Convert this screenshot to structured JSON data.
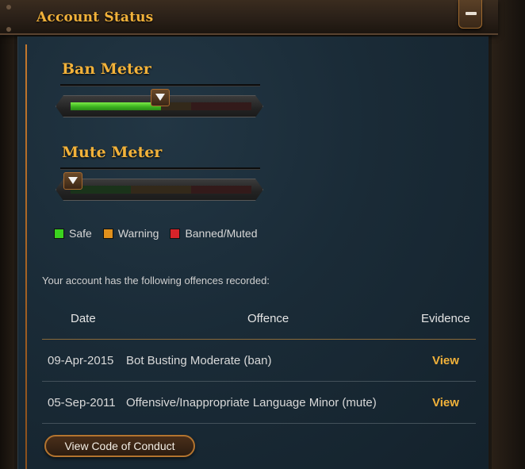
{
  "header": {
    "title": "Account Status"
  },
  "ban_meter": {
    "title": "Ban Meter",
    "level": 0.5
  },
  "mute_meter": {
    "title": "Mute Meter",
    "level": 0.0
  },
  "legend": [
    {
      "label": "Safe",
      "color": "#3bd21f"
    },
    {
      "label": "Warning",
      "color": "#e0901c"
    },
    {
      "label": "Banned/Muted",
      "color": "#d8232a"
    }
  ],
  "intro_text": "Your account has the following offences recorded:",
  "table": {
    "headers": {
      "date": "Date",
      "offence": "Offence",
      "evidence": "Evidence"
    },
    "rows": [
      {
        "date": "09-Apr-2015",
        "offence": "Bot Busting Moderate (ban)",
        "evidence": "View"
      },
      {
        "date": "05-Sep-2011",
        "offence": "Offensive/Inappropriate Language Minor (mute)",
        "evidence": "View"
      }
    ]
  },
  "code_of_conduct_button": "View Code of Conduct",
  "colors": {
    "accent": "#f2b23a",
    "panel": "#1a2b37"
  },
  "icons": {
    "collapse": "minus-icon",
    "meter_pointer": "triangle-down-icon"
  }
}
